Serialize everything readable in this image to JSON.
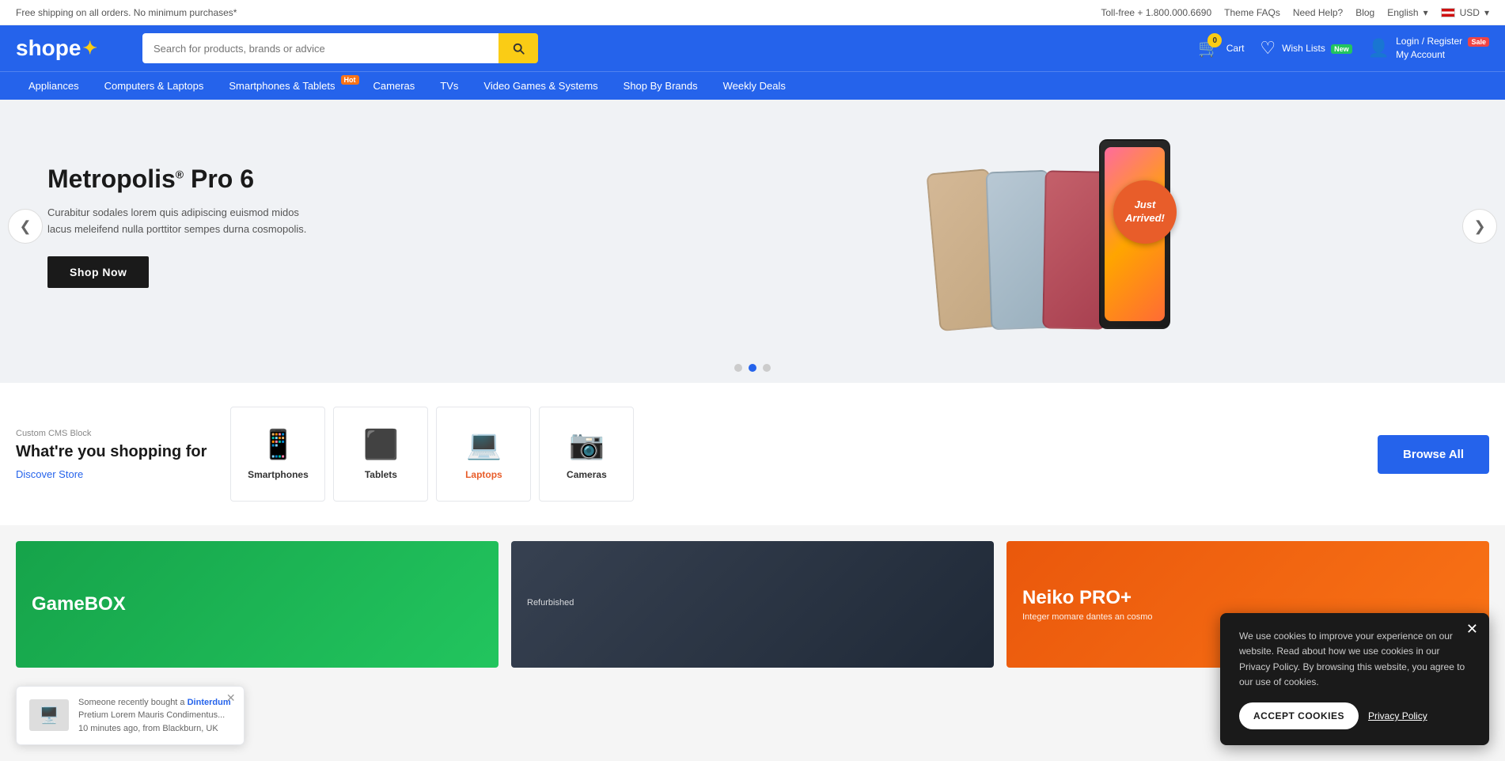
{
  "topbar": {
    "promo_text": "Free shipping on all orders. No minimum purchases*",
    "phone": "Toll-free + 1.800.000.6690",
    "theme_faqs": "Theme FAQs",
    "need_help": "Need Help?",
    "blog": "Blog",
    "language": "English",
    "currency": "USD"
  },
  "header": {
    "logo": "shope",
    "logo_star": "✦",
    "search_placeholder": "Search for products, brands or advice",
    "cart_label": "Cart",
    "cart_badge": "0",
    "wishlist_label": "Wish Lists",
    "wishlist_new_badge": "New",
    "login_label": "Login / Register",
    "account_label": "My Account",
    "account_sale_badge": "Sale"
  },
  "nav": {
    "items": [
      {
        "label": "Appliances",
        "badge": null
      },
      {
        "label": "Computers & Laptops",
        "badge": null
      },
      {
        "label": "Smartphones & Tablets",
        "badge": "Hot"
      },
      {
        "label": "Cameras",
        "badge": null
      },
      {
        "label": "TVs",
        "badge": null
      },
      {
        "label": "Video Games & Systems",
        "badge": null
      },
      {
        "label": "Shop By Brands",
        "badge": null
      },
      {
        "label": "Weekly Deals",
        "badge": null
      }
    ]
  },
  "hero": {
    "title": "Metropolis",
    "title_reg": "®",
    "title_suffix": " Pro 6",
    "description": "Curabitur sodales lorem quis adipiscing euismod midos lacus meleifend nulla porttitor sempes durna cosmopolis.",
    "cta_label": "Shop Now",
    "just_arrived_line1": "Just",
    "just_arrived_line2": "Arrived!"
  },
  "slider": {
    "dots": [
      {
        "active": false
      },
      {
        "active": true
      },
      {
        "active": false
      }
    ],
    "prev_label": "❮",
    "next_label": "❯"
  },
  "categories": {
    "cms_label": "Custom CMS Block",
    "title": "What're you shopping for",
    "discover_label": "Discover Store",
    "browse_all_label": "Browse All",
    "items": [
      {
        "icon": "📱",
        "label": "Smartphones",
        "active": false
      },
      {
        "icon": "⬛",
        "label": "Tablets",
        "active": false
      },
      {
        "icon": "💻",
        "label": "Laptops",
        "active": true
      },
      {
        "icon": "📷",
        "label": "Cameras",
        "active": false
      }
    ]
  },
  "promos": [
    {
      "label": "",
      "title": "GameBOX",
      "subtitle": "",
      "color_class": "promo-green"
    },
    {
      "label": "Refurbished",
      "title": "",
      "subtitle": "",
      "color_class": "promo-gray"
    },
    {
      "label": "",
      "title": "Neiko PRO+",
      "subtitle": "Integer momare dantes an cosmo",
      "color_class": "promo-orange"
    }
  ],
  "cookie": {
    "message": "We use cookies to improve your experience on our website. Read about how we use cookies in our Privacy Policy. By browsing this website, you agree to our use of cookies.",
    "accept_label": "ACCEPT COOKIES",
    "privacy_label": "Privacy Policy"
  },
  "toast": {
    "prefix": "Someone recently bought a",
    "product_name": "Dinterdum",
    "product_desc": "Pretium Lorem Mauris Condimentus...",
    "time": "10 minutes ago, from Blackburn, UK"
  }
}
